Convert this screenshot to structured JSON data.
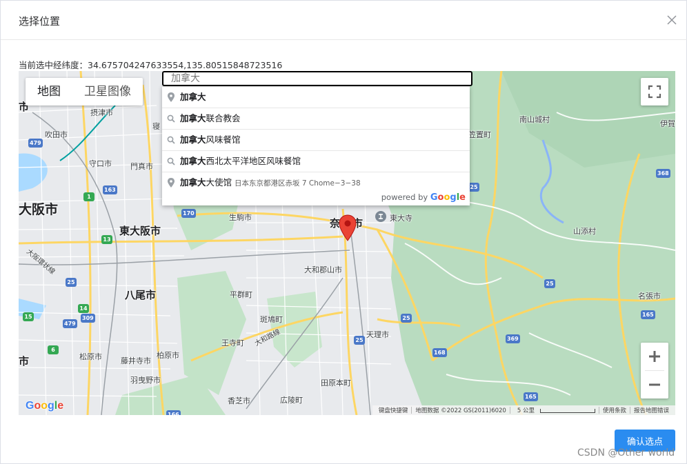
{
  "dialog": {
    "title": "选择位置",
    "close_icon": "close-icon"
  },
  "coords": {
    "text": "当前选中经纬度：34.675704247633554,135.80515848723516"
  },
  "map": {
    "maptype": {
      "map_label": "地图",
      "satellite_label": "卫星图像"
    },
    "search": {
      "value": "",
      "placeholder": "加拿大"
    },
    "autocomplete": [
      {
        "icon": "pin-icon",
        "match": "加拿大",
        "rest": "",
        "secondary": ""
      },
      {
        "icon": "search-icon",
        "match": "加拿大",
        "rest": "联合教会",
        "secondary": ""
      },
      {
        "icon": "search-icon",
        "match": "加拿大",
        "rest": "风味餐馆",
        "secondary": ""
      },
      {
        "icon": "search-icon",
        "match": "加拿大",
        "rest": "西北太平洋地区风味餐馆",
        "secondary": ""
      },
      {
        "icon": "pin-icon",
        "match": "加拿大",
        "rest": "大使馆",
        "secondary": "日本东京都港区赤坂 7 Chome−3−38"
      }
    ],
    "powered_by": "powered by",
    "powered_brand": "Google",
    "logo": "Google",
    "attribution": {
      "shortcuts": "键盘快捷键",
      "map_data": "地图数据 ©2022 GS(2011)6020",
      "scale": "5 公里",
      "terms": "使用条款",
      "report": "报告地图错误"
    },
    "labels": {
      "osaka": "大阪市",
      "higashiosaka": "東大阪市",
      "yao": "八尾市",
      "nara": "奈",
      "nara2": "市",
      "settsu": "摂津市",
      "suita": "吹田市",
      "moriguchi": "守口市",
      "kadoma": "門真市",
      "neyagawa": "寝",
      "ikoma": "生駒市",
      "yamatokoriyama": "大和郡山市",
      "heguri": "平群町",
      "ikaruga": "斑鳩町",
      "oji": "王寺町",
      "tenri": "天理市",
      "kashiwara": "柏原市",
      "fujiidera": "藤井寺市",
      "matsubara": "松原市",
      "habikino": "羽曳野市",
      "tawaramoto": "田原本町",
      "kashiba": "香芝市",
      "koryo": "広陵町",
      "todaiji": "東大寺",
      "minamiyamashiro": "南山城村",
      "kasagi": "笠置町",
      "yamazoe": "山添村",
      "nabari": "名張市",
      "iga": "伊賀",
      "city_left": "市",
      "city_left2": "堺市",
      "osaka_line": "大阪環状線",
      "yamatoji": "大和路線"
    },
    "shields": [
      "479",
      "163",
      "1",
      "13",
      "170",
      "25",
      "14",
      "309",
      "479",
      "15",
      "6",
      "25",
      "369",
      "25",
      "25",
      "165",
      "368",
      "25",
      "166",
      "165",
      "168"
    ]
  },
  "footer": {
    "confirm_label": "确认选点"
  },
  "watermark": "CSDN @Other world"
}
